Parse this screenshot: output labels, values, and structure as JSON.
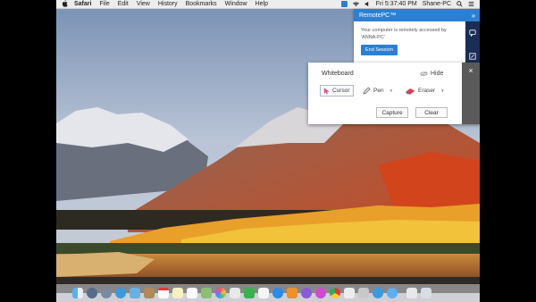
{
  "menubar": {
    "apple": "",
    "items": [
      "Safari",
      "File",
      "Edit",
      "View",
      "History",
      "Bookmarks",
      "Window",
      "Help"
    ],
    "clock": "Fri 5:37:40 PM",
    "user": "Shane-PC"
  },
  "remotepc": {
    "title": "RemotePC™",
    "message": "Your computer is remotely accessed by 'ANNA-PC'",
    "end_button": "End Session",
    "accent": "#2d7fd1"
  },
  "whiteboard": {
    "title": "Whiteboard",
    "hide_label": "Hide",
    "tools": {
      "cursor": "Cursor",
      "pen": "Pen",
      "eraser": "Eraser"
    },
    "capture_button": "Capture",
    "clear_button": "Clear",
    "close_icon": "×"
  },
  "dock": {
    "apps": [
      "finder",
      "launchpad",
      "rocket",
      "safari",
      "photos",
      "contacts",
      "calendar",
      "notes",
      "reminders",
      "maps",
      "photos-app",
      "messages",
      "facetime",
      "itunes",
      "app-store",
      "books",
      "settings",
      "itunes-2",
      "chrome",
      "mail",
      "script-editor",
      "remotepc",
      "remotepc-2",
      "files",
      "trash"
    ]
  }
}
